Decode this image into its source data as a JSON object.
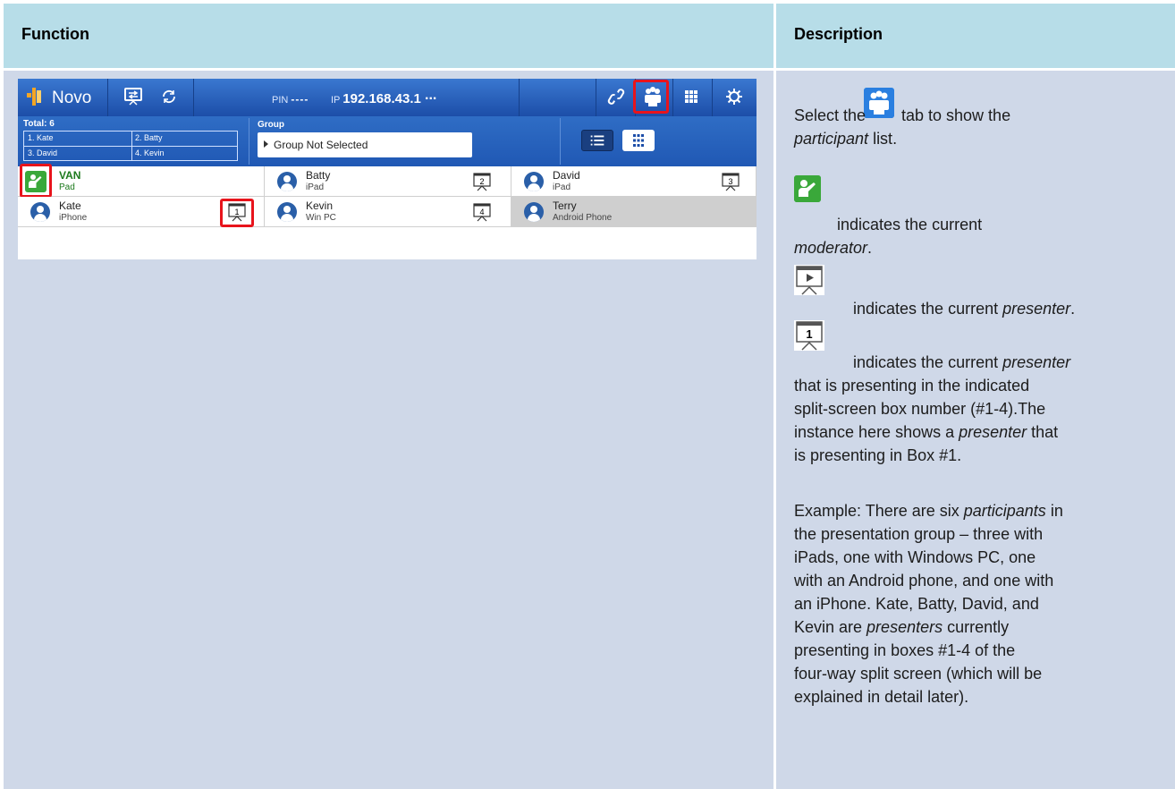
{
  "table": {
    "header_function": "Function",
    "header_description": "Description"
  },
  "app": {
    "name": "Novo",
    "pin_label": "PIN",
    "pin_value": "----",
    "ip_label": "IP",
    "ip_value": "192.168.43.1",
    "more": "...",
    "total_label": "Total: 6",
    "total_cells": [
      "1. Kate",
      "2. Batty",
      "3. David",
      "4. Kevin"
    ],
    "group_label": "Group",
    "group_value": "Group Not Selected",
    "participants": [
      {
        "name": "VAN",
        "device": "Pad",
        "role": "moderator",
        "box": ""
      },
      {
        "name": "Batty",
        "device": "iPad",
        "role": "presenter",
        "box": "2"
      },
      {
        "name": "David",
        "device": "iPad",
        "role": "presenter",
        "box": "3"
      },
      {
        "name": "Kate",
        "device": "iPhone",
        "role": "presenter",
        "box": "1"
      },
      {
        "name": "Kevin",
        "device": "Win PC",
        "role": "presenter",
        "box": "4"
      },
      {
        "name": "Terry",
        "device": "Android Phone",
        "role": "participant",
        "box": ""
      }
    ],
    "icons": [
      "screen-share-icon",
      "refresh-icon",
      "link-icon",
      "participants-icon",
      "grid-icon",
      "gear-icon"
    ]
  },
  "desc": {
    "line1_pre": "Select the",
    "line1_post": "tab to show the",
    "line2_italic": "participant",
    "line2_post": " list.",
    "mod_post": "indicates the current",
    "mod_italic": "moderator",
    "mod_end": ".",
    "pres_post": "indicates the current ",
    "pres_italic": "presenter",
    "pres_end": ".",
    "box_post": "indicates the current ",
    "box_italic": "presenter",
    "box_lines": [
      "that is presenting in the indicated",
      "split-screen box number (#1-4).The"
    ],
    "box_line4_pre": "instance here shows a ",
    "box_line4_italic": "presenter",
    "box_line4_post": " that",
    "box_line5": "is presenting in Box #1.",
    "ex1_pre": "Example: There are six ",
    "ex1_italic": "participants",
    "ex1_post": " in",
    "ex_lines": [
      "the presentation group – three with",
      "iPads, one with Windows PC, one",
      "with an Android phone, and one with",
      "an iPhone. Kate, Batty, David, and"
    ],
    "ex6_pre": "Kevin are ",
    "ex6_italic": "presenters",
    "ex6_post": " currently",
    "ex_tail": [
      "presenting in boxes #1-4 of the",
      "four-way split screen (which will be",
      "explained in detail later)."
    ]
  },
  "colors": {
    "header_bg": "#b7dde8",
    "cell_bg": "#cfd8e8",
    "highlight_red": "#e8141c",
    "app_blue": "#2058b4",
    "moderator_green": "#3aa83a"
  }
}
